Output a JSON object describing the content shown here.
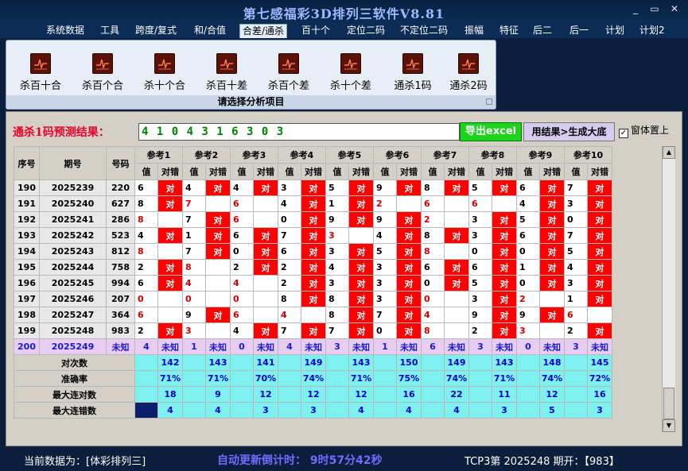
{
  "window": {
    "title": "第七感福彩3D排列三软件V8.81",
    "minimize": "_",
    "restore": "▭",
    "close": "✕"
  },
  "menu": [
    "系统数据",
    "工具",
    "跨度/复式",
    "和/合值",
    "合差/通杀",
    "百十个",
    "定位二码",
    "不定位二码",
    "振幅",
    "特征",
    "后二",
    "后一",
    "计划",
    "计划2"
  ],
  "menu_active_index": 4,
  "ribbon": {
    "buttons": [
      "杀百十合",
      "杀百个合",
      "杀十个合",
      "杀百十差",
      "杀百个差",
      "杀十个差",
      "通杀1码",
      "通杀2码"
    ],
    "caption": "请选择分析项目",
    "icon": "chart-icon"
  },
  "prediction": {
    "label": "通杀1码预测结果：",
    "value": "4 1 0 4 3 1 6 3 0 3"
  },
  "buttons": {
    "excel": "导出excel",
    "big": "用结果>生成大底",
    "ontop": "窗体置上",
    "ontop_checked": "✓"
  },
  "table": {
    "header": {
      "seq": "序号",
      "issue": "期号",
      "num": "号码",
      "refs": [
        "参考1",
        "参考2",
        "参考3",
        "参考4",
        "参考5",
        "参考6",
        "参考7",
        "参考8",
        "参考9",
        "参考10"
      ],
      "val": "值",
      "hit": "对错"
    },
    "hit_word": "对",
    "rows": [
      {
        "seq": "190",
        "issue": "2025239",
        "num": "220",
        "vals": [
          "6",
          "4",
          "4",
          "3",
          "5",
          "9",
          "8",
          "5",
          "6",
          "7"
        ],
        "hits": [
          1,
          1,
          1,
          1,
          1,
          1,
          1,
          1,
          1,
          1
        ]
      },
      {
        "seq": "191",
        "issue": "2025240",
        "num": "627",
        "vals": [
          "8",
          "7",
          "6",
          "4",
          "1",
          "2",
          "6",
          "6",
          "4",
          "3"
        ],
        "hits": [
          1,
          0,
          0,
          1,
          1,
          0,
          0,
          0,
          1,
          1
        ]
      },
      {
        "seq": "192",
        "issue": "2025241",
        "num": "286",
        "vals": [
          "8",
          "7",
          "6",
          "0",
          "9",
          "9",
          "2",
          "3",
          "5",
          "0"
        ],
        "hits": [
          0,
          1,
          0,
          1,
          1,
          1,
          0,
          1,
          1,
          1
        ]
      },
      {
        "seq": "193",
        "issue": "2025242",
        "num": "523",
        "vals": [
          "4",
          "1",
          "6",
          "7",
          "3",
          "4",
          "8",
          "3",
          "6",
          "7"
        ],
        "hits": [
          1,
          1,
          1,
          1,
          0,
          1,
          1,
          1,
          1,
          1
        ]
      },
      {
        "seq": "194",
        "issue": "2025243",
        "num": "812",
        "vals": [
          "8",
          "7",
          "0",
          "6",
          "3",
          "5",
          "8",
          "0",
          "0",
          "5"
        ],
        "hits": [
          0,
          1,
          1,
          1,
          1,
          1,
          0,
          1,
          1,
          1
        ]
      },
      {
        "seq": "195",
        "issue": "2025244",
        "num": "758",
        "vals": [
          "2",
          "8",
          "2",
          "2",
          "4",
          "3",
          "6",
          "6",
          "1",
          "4"
        ],
        "hits": [
          1,
          0,
          1,
          1,
          1,
          1,
          1,
          1,
          1,
          1
        ]
      },
      {
        "seq": "196",
        "issue": "2025245",
        "num": "994",
        "vals": [
          "6",
          "4",
          "4",
          "2",
          "3",
          "3",
          "0",
          "5",
          "0",
          "3"
        ],
        "hits": [
          1,
          0,
          0,
          1,
          1,
          1,
          1,
          1,
          1,
          1
        ]
      },
      {
        "seq": "197",
        "issue": "2025246",
        "num": "207",
        "vals": [
          "0",
          "0",
          "0",
          "8",
          "8",
          "3",
          "0",
          "3",
          "2",
          "1"
        ],
        "hits": [
          0,
          0,
          0,
          1,
          1,
          1,
          0,
          1,
          0,
          1
        ]
      },
      {
        "seq": "198",
        "issue": "2025247",
        "num": "364",
        "vals": [
          "6",
          "9",
          "6",
          "4",
          "8",
          "7",
          "4",
          "9",
          "9",
          "6"
        ],
        "hits": [
          0,
          1,
          0,
          0,
          1,
          1,
          0,
          1,
          1,
          0
        ]
      },
      {
        "seq": "199",
        "issue": "2025248",
        "num": "983",
        "vals": [
          "2",
          "3",
          "4",
          "7",
          "7",
          "0",
          "8",
          "2",
          "3",
          "2"
        ],
        "hits": [
          1,
          0,
          1,
          1,
          1,
          1,
          0,
          1,
          0,
          1
        ]
      }
    ],
    "current": {
      "seq": "200",
      "issue": "2025249",
      "num": "未知",
      "vals": [
        "4",
        "1",
        "0",
        "4",
        "3",
        "1",
        "6",
        "3",
        "0",
        "3"
      ],
      "unknown": "未知"
    },
    "stats": [
      {
        "label": "对次数",
        "values": [
          "142",
          "143",
          "141",
          "149",
          "143",
          "150",
          "149",
          "143",
          "148",
          "145"
        ]
      },
      {
        "label": "准确率",
        "values": [
          "71%",
          "71%",
          "70%",
          "74%",
          "71%",
          "75%",
          "74%",
          "71%",
          "74%",
          "72%"
        ]
      },
      {
        "label": "最大连对数",
        "values": [
          "18",
          "9",
          "12",
          "12",
          "12",
          "16",
          "22",
          "11",
          "12",
          "16"
        ]
      },
      {
        "label": "最大连错数",
        "values": [
          "4",
          "4",
          "3",
          "3",
          "4",
          "4",
          "4",
          "3",
          "5",
          "3"
        ]
      }
    ]
  },
  "status": {
    "source": "当前数据为：[体彩排列三]",
    "countdown": "自动更新倒计时：  9时57分42秒",
    "draw": "TCP3第  2025248  期开：【983】"
  }
}
